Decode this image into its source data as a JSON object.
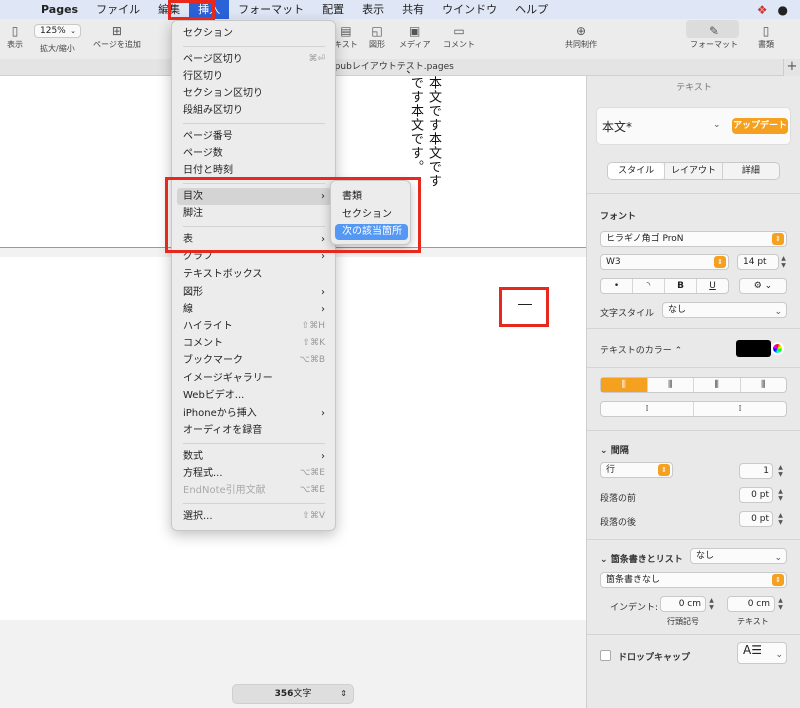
{
  "menubar": {
    "apple": "",
    "app": "Pages",
    "items": [
      "ファイル",
      "編集",
      "挿入",
      "フォーマット",
      "配置",
      "表示",
      "共有",
      "ウインドウ",
      "ヘルプ"
    ],
    "active_index": 2
  },
  "toolbar": {
    "view_label": "表示",
    "zoom_value": "125%",
    "zoom_label": "拡大/縮小",
    "add_page_label": "ページを追加",
    "text_label": "キスト",
    "shape_label": "図形",
    "media_label": "メディア",
    "comment_label": "コメント",
    "collaborate_label": "共同制作",
    "format_label": "フォーマット",
    "document_label": "書類"
  },
  "document": {
    "filename": "epubレイアウトテスト.pages",
    "columns": [
      "本文です本文です",
      "です本文です。",
      "、"
    ],
    "word_count_num": "356",
    "word_count_unit": "文字",
    "dash": "—"
  },
  "insert_menu": {
    "items": [
      {
        "label": "セクション",
        "shortcut": "",
        "arrow": false,
        "disabled": false
      },
      {
        "label": "ページ区切り",
        "shortcut": "⌘⏎",
        "arrow": false,
        "disabled": false
      },
      {
        "label": "行区切り",
        "shortcut": "",
        "arrow": false,
        "disabled": false
      },
      {
        "label": "セクション区切り",
        "shortcut": "",
        "arrow": false,
        "disabled": false
      },
      {
        "label": "段組み区切り",
        "shortcut": "",
        "arrow": false,
        "disabled": false
      },
      {
        "label": "ページ番号",
        "shortcut": "",
        "arrow": false,
        "disabled": false
      },
      {
        "label": "ページ数",
        "shortcut": "",
        "arrow": false,
        "disabled": false
      },
      {
        "label": "日付と時刻",
        "shortcut": "",
        "arrow": false,
        "disabled": false
      },
      {
        "label": "目次",
        "shortcut": "",
        "arrow": true,
        "disabled": false
      },
      {
        "label": "脚注",
        "shortcut": "",
        "arrow": false,
        "disabled": false
      },
      {
        "label": "表",
        "shortcut": "",
        "arrow": true,
        "disabled": false
      },
      {
        "label": "グラフ",
        "shortcut": "",
        "arrow": true,
        "disabled": false
      },
      {
        "label": "テキストボックス",
        "shortcut": "",
        "arrow": false,
        "disabled": false
      },
      {
        "label": "図形",
        "shortcut": "",
        "arrow": true,
        "disabled": false
      },
      {
        "label": "線",
        "shortcut": "",
        "arrow": true,
        "disabled": false
      },
      {
        "label": "ハイライト",
        "shortcut": "⇧⌘H",
        "arrow": false,
        "disabled": false
      },
      {
        "label": "コメント",
        "shortcut": "⇧⌘K",
        "arrow": false,
        "disabled": false
      },
      {
        "label": "ブックマーク",
        "shortcut": "⌥⌘B",
        "arrow": false,
        "disabled": false
      },
      {
        "label": "イメージギャラリー",
        "shortcut": "",
        "arrow": false,
        "disabled": false
      },
      {
        "label": "Webビデオ...",
        "shortcut": "",
        "arrow": false,
        "disabled": false
      },
      {
        "label": "iPhoneから挿入",
        "shortcut": "",
        "arrow": true,
        "disabled": false
      },
      {
        "label": "オーディオを録音",
        "shortcut": "",
        "arrow": false,
        "disabled": false
      },
      {
        "label": "数式",
        "shortcut": "",
        "arrow": true,
        "disabled": false
      },
      {
        "label": "方程式...",
        "shortcut": "⌥⌘E",
        "arrow": false,
        "disabled": false
      },
      {
        "label": "EndNote引用文献",
        "shortcut": "⌥⌘E",
        "arrow": false,
        "disabled": true
      },
      {
        "label": "選択...",
        "shortcut": "⇧⌘V",
        "arrow": false,
        "disabled": false
      }
    ]
  },
  "toc_submenu": {
    "items": [
      "書類",
      "セクション",
      "次の該当箇所"
    ],
    "selected_index": 2
  },
  "sidebar": {
    "header": "テキスト",
    "paragraph_style": "本文*",
    "update_button": "アップデート",
    "tabs": [
      "スタイル",
      "レイアウト",
      "詳細"
    ],
    "font_section": "フォント",
    "font_name": "ヒラギノ角ゴ ProN",
    "font_weight": "W3",
    "font_size": "14 pt",
    "style_buttons": [
      "•",
      "◝",
      "B",
      "U"
    ],
    "char_style_label": "文字スタイル",
    "char_style_value": "なし",
    "text_color_label": "テキストのカラー",
    "spacing_section": "間隔",
    "line_label": "行",
    "line_value": "1",
    "before_label": "段落の前",
    "before_value": "0 pt",
    "after_label": "段落の後",
    "after_value": "0 pt",
    "bullets_label": "箇条書きとリスト",
    "bullets_value": "なし",
    "bullets_style": "箇条書きなし",
    "indent_label": "インデント:",
    "indent_bullet_value": "0 cm",
    "indent_text_value": "0 cm",
    "indent_bullet_caption": "行頭記号",
    "indent_text_caption": "テキスト",
    "dropcap_label": "ドロップキャップ"
  }
}
